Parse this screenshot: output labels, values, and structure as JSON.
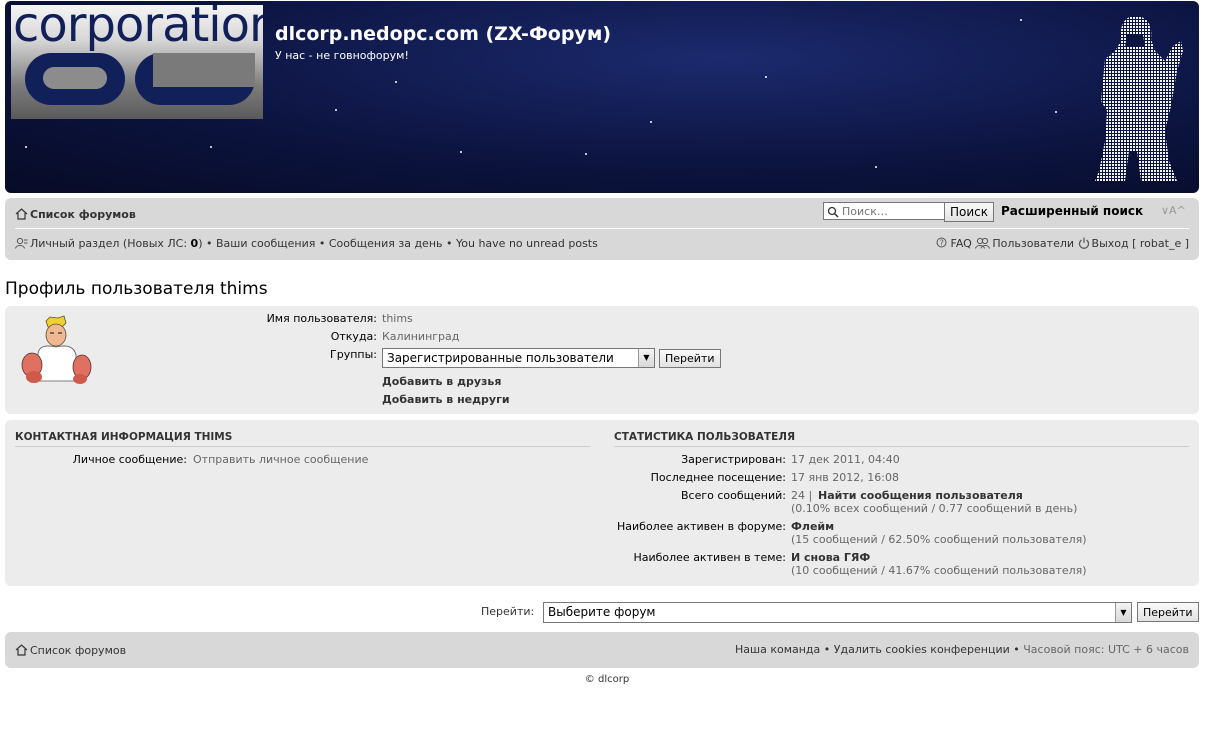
{
  "header": {
    "logo_text": "corporation",
    "site_title": "dlcorp.nedopc.com (ZX-Форум)",
    "site_description": "У нас - не говнофорум!"
  },
  "nav": {
    "forum_index": "Список форумов",
    "search_placeholder": "Поиск…",
    "search_button": "Поиск",
    "advanced_search": "Расширенный поиск",
    "font_size": "∨A^",
    "ucp_label": "Личный раздел",
    "new_pm_prefix": "(Новых ЛС: ",
    "new_pm_count": "0",
    "new_pm_suffix": ")",
    "your_posts": "Ваши сообщения",
    "active_posts": "Сообщения за день",
    "unread_posts": "You have no unread posts",
    "faq": "FAQ",
    "members": "Пользователи",
    "logout": "Выход",
    "logout_user": "[ robat_e ]"
  },
  "page": {
    "heading": "Профиль пользователя thims"
  },
  "profile": {
    "username_label": "Имя пользователя:",
    "username": "thims",
    "location_label": "Откуда:",
    "location": "Калининград",
    "groups_label": "Группы:",
    "group_selected": "Зарегистрированные пользователи",
    "go_button": "Перейти",
    "add_friend": "Добавить в друзья",
    "add_foe": "Добавить в недруги"
  },
  "contact": {
    "title": "КОНТАКТНАЯ ИНФОРМАЦИЯ THIMS",
    "pm_label": "Личное сообщение:",
    "pm_value": "Отправить личное сообщение"
  },
  "stats": {
    "title": "СТАТИСТИКА ПОЛЬЗОВАТЕЛЯ",
    "registered_label": "Зарегистрирован:",
    "registered": "17 дек 2011, 04:40",
    "last_visit_label": "Последнее посещение:",
    "last_visit": "17 янв 2012, 16:08",
    "total_posts_label": "Всего сообщений:",
    "total_posts": "24 |",
    "find_posts": "Найти сообщения пользователя",
    "posts_pct": "(0.10% всех сообщений / 0.77 сообщений в день)",
    "active_forum_label": "Наиболее активен в форуме:",
    "active_forum": "Флейм",
    "active_forum_detail": "(15 сообщений / 62.50% сообщений пользователя)",
    "active_topic_label": "Наиболее активен в теме:",
    "active_topic": "И снова ГЯФ",
    "active_topic_detail": "(10 сообщений / 41.67% сообщений пользователя)"
  },
  "jumpbox": {
    "label": "Перейти:",
    "selected": "Выберите форум",
    "button": "Перейти"
  },
  "footer": {
    "forum_index": "Список форумов",
    "team": "Наша команда",
    "delete_cookies": "Удалить cookies конференции",
    "timezone": "Часовой пояс: UTC + 6 часов",
    "copyright": "© dlcorp"
  },
  "icons": [
    "home-icon",
    "search-icon",
    "ucp-icon",
    "faq-icon",
    "members-icon",
    "logout-icon"
  ]
}
